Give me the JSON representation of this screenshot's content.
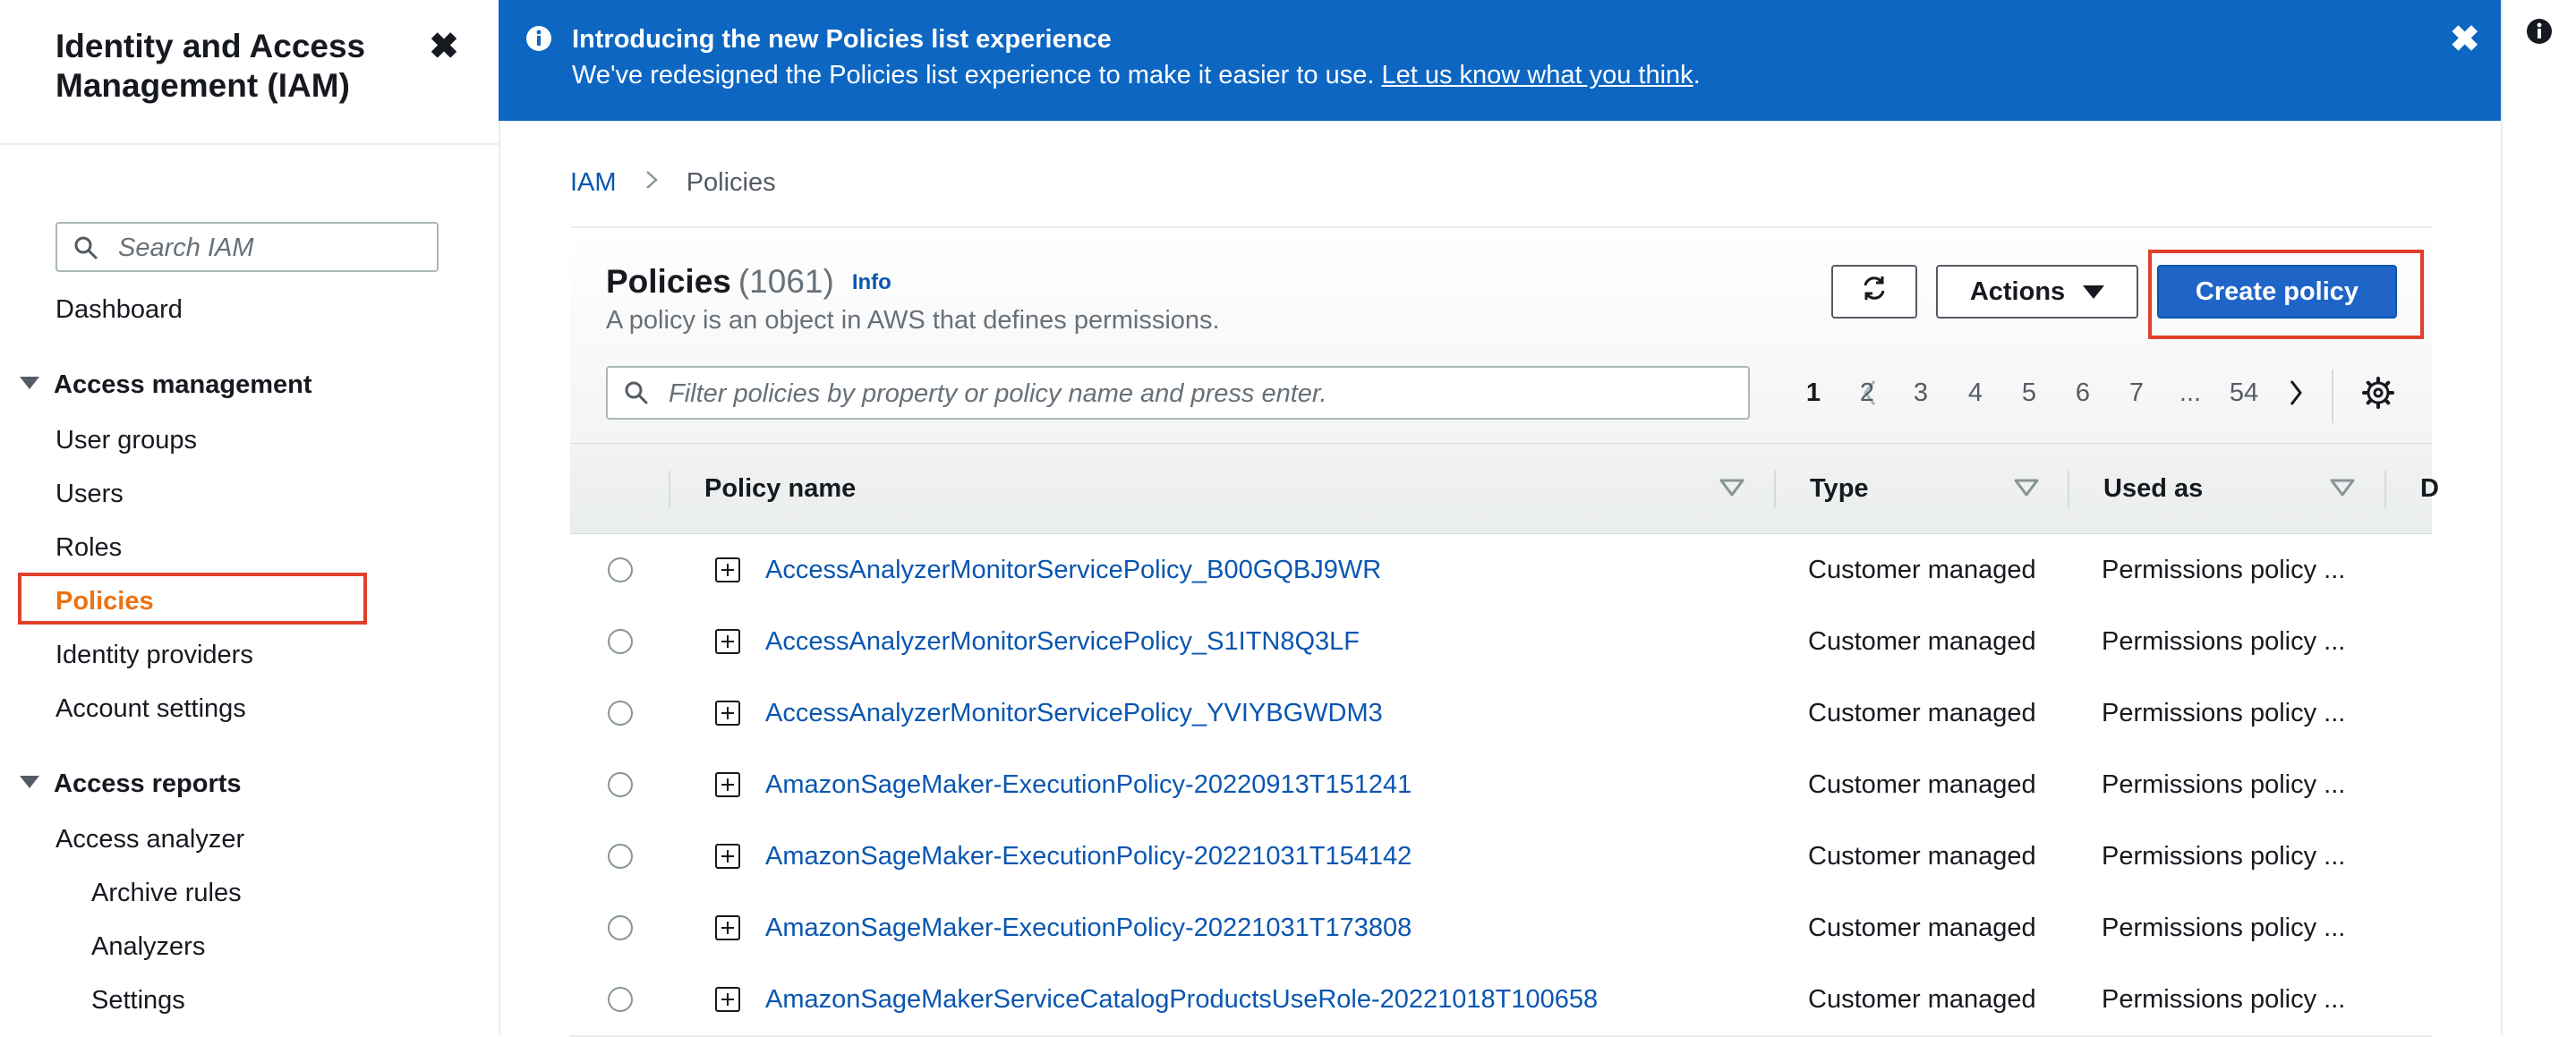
{
  "sidebar": {
    "title": "Identity and Access Management (IAM)",
    "close_glyph": "✖",
    "search_placeholder": "Search IAM",
    "dashboard": "Dashboard",
    "access_management": {
      "label": "Access management",
      "items": [
        "User groups",
        "Users",
        "Roles",
        "Policies",
        "Identity providers",
        "Account settings"
      ],
      "active": "Policies"
    },
    "access_reports": {
      "label": "Access reports",
      "items": [
        "Access analyzer"
      ],
      "sub_items": [
        "Archive rules",
        "Analyzers",
        "Settings"
      ]
    }
  },
  "banner": {
    "title": "Introducing the new Policies list experience",
    "text": "We've redesigned the Policies list experience to make it easier to use.",
    "link": "Let us know what you think",
    "link_suffix": ".",
    "close_glyph": "✖"
  },
  "breadcrumb": {
    "root": "IAM",
    "current": "Policies"
  },
  "panel": {
    "title": "Policies",
    "count": "(1061)",
    "info": "Info",
    "description": "A policy is an object in AWS that defines permissions.",
    "actions_label": "Actions",
    "create_label": "Create policy",
    "filter_placeholder": "Filter policies by property or policy name and press enter.",
    "pagination": {
      "current": "1",
      "pages": [
        "1",
        "2",
        "3",
        "4",
        "5",
        "6",
        "7",
        "...",
        "54"
      ]
    }
  },
  "table": {
    "columns": [
      "Policy name",
      "Type",
      "Used as",
      "D"
    ],
    "rows": [
      {
        "name": "AccessAnalyzerMonitorServicePolicy_B00GQBJ9WR",
        "type": "Customer managed",
        "used_as": "Permissions policy ..."
      },
      {
        "name": "AccessAnalyzerMonitorServicePolicy_S1ITN8Q3LF",
        "type": "Customer managed",
        "used_as": "Permissions policy ..."
      },
      {
        "name": "AccessAnalyzerMonitorServicePolicy_YVIYBGWDM3",
        "type": "Customer managed",
        "used_as": "Permissions policy ..."
      },
      {
        "name": "AmazonSageMaker-ExecutionPolicy-20220913T151241",
        "type": "Customer managed",
        "used_as": "Permissions policy ..."
      },
      {
        "name": "AmazonSageMaker-ExecutionPolicy-20221031T154142",
        "type": "Customer managed",
        "used_as": "Permissions policy ..."
      },
      {
        "name": "AmazonSageMaker-ExecutionPolicy-20221031T173808",
        "type": "Customer managed",
        "used_as": "Permissions policy ..."
      },
      {
        "name": "AmazonSageMakerServiceCatalogProductsUseRole-20221018T100658",
        "type": "Customer managed",
        "used_as": "Permissions policy ..."
      }
    ]
  },
  "colors": {
    "link": "#0a56b0",
    "primary_button": "#1f65c8",
    "banner": "#0d66c2",
    "active_nav": "#ec7211",
    "highlight": "#e0402a"
  },
  "icons": [
    "close-icon",
    "search-icon",
    "info-icon",
    "refresh-icon",
    "caret-down-icon",
    "chevron-left-icon",
    "chevron-right-icon",
    "gear-icon",
    "sort-icon",
    "expand-icon"
  ]
}
